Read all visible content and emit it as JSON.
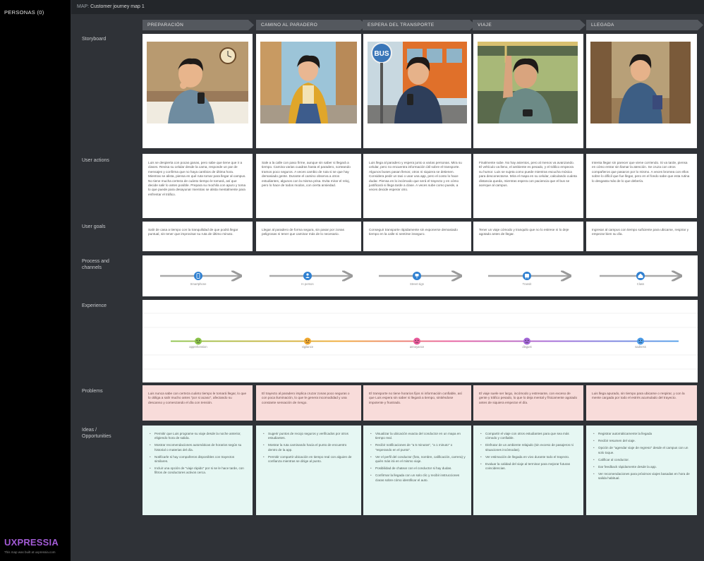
{
  "sidebar": {
    "personas_label": "PERSONAS (0)",
    "brand": "UXPRESSIA",
    "brand_sub": "This map was built at uxpressia.com"
  },
  "topbar": {
    "prefix": "MAP:",
    "title": "Customer journey map 1"
  },
  "stages": [
    "PREPARACIÓN",
    "CAMINO AL PARADERO",
    "ESPERA DEL TRANSPORTE",
    "VIAJE",
    "LLEGADA"
  ],
  "rows": {
    "storyboard": "Storyboard",
    "actions": "User actions",
    "goals": "User goals",
    "process": "Process and channels",
    "experience": "Experience",
    "problems": "Problems",
    "ideas": "Ideas / Opportunities"
  },
  "actions": [
    "Luis se despierta con pocas ganas, pero sabe que tiene que ir a clases. Revisa su celular desde la cama, responde un par de mensajes y confirma que no haya cambios de última hora. Mientras se alista, piensa en qué ruta tomar para llegar al campus. No tiene mucha certeza de cuánto tiempo le tomará, así que decide salir lo antes posible. Prepara su mochila con apuro y toma lo que puede para desayunar mientras se alista mentalmente para enfrentar el tráfico.",
    "Sale a la calle con paso firme, aunque sin saber si llegará a tiempo. Camina varias cuadras hasta el paradero, sorteando  tramos poco seguros. A veces cambio de ruta si se que hay demasiado gente. Durante el camino observa a otros estudiantes, algunos con la misma prisa. Evita mirar el reloj, pero lo hace de todos modos, con cierta ansiedad.",
    "Luis llega al paradero y espera junto a varias personas. Mira su celular, pero no encuentra información útil sobre el transporte. Algunos buses pasan llenos; otros ni siquiera se detienen. Considera pedir un taxi o usar una app, pero el costo lo hace dudar. Piensa en lo incómodo que será el trayecto y en cómo justificará si llega tarde a clase. A veces sube como puede, a veces decide esperar otro.",
    "Finalmente sube. No hay asientos, pero al menos va avanzando. El vehículo va lleno, el ambiente es pesado, y el tráfico empeora su humor. Luis se sujeta como puede mientras escucha música para desconectarse. Mira el mapa en su celular, calculando cuánta distancia queda, mientras espera con paciencia que el bus se acerque al campus.",
    "Intenta llegar sin parecer que viene corriendo. Si va tarde, piensa en cómo entrar sin llamar la atención. Se cruza con otros compañeros que pasaron por lo mismo. A veces bromea con ellos sobre lo difícil que fue llegar, pero en el fondo sabe que esta rutina lo desgasta más de lo que debería."
  ],
  "goals": [
    "Salir de casa a tiempo con la tranquilidad de que podrá llegar puntual, sin tener que improvisar su ruta de último minuto.",
    "Llegar al paradero de forma segura, sin pasar por zonas peligrosas ni tener que caminar más de lo necesario.",
    "Conseguir transporte rápidamente sin exponerse demasiado tiempo en la calle ni sentirse inseguro.",
    "Tener un viaje cómodo y tranquilo que no lo estrese ni lo deje agotado antes de llegar.",
    "Ingresar al campus con tiempo suficiente para ubicarse, respirar y empezar bien su día."
  ],
  "channels": [
    {
      "label": "Smartphone",
      "icon": "smartphone-icon"
    },
    {
      "label": "In person",
      "icon": "person-icon"
    },
    {
      "label": "Street sign",
      "icon": "street-sign-icon"
    },
    {
      "label": "Transit",
      "icon": "transit-icon"
    },
    {
      "label": "Class",
      "icon": "class-icon"
    }
  ],
  "experience": [
    {
      "label": "apprehension",
      "score": 0.0,
      "color": "#8bc34a"
    },
    {
      "label": "vigilance",
      "score": 0.0,
      "color": "#f0a830"
    },
    {
      "label": "annoyance",
      "score": 0.0,
      "color": "#e85a9a"
    },
    {
      "label": "disgust",
      "score": 0.0,
      "color": "#a266d6"
    },
    {
      "label": "sadness",
      "score": 0.0,
      "color": "#4a9be8"
    }
  ],
  "problems": [
    "Luis nunca sabe con certeza cuánto tiempo le tomará llegar, lo que lo obliga a salir mucho antes \"por si acaso\", afectando su descanso y comenzando el día con tensión.",
    "El trayecto al paradero implica cruzar zonas poco seguras o con poca iluminación, lo que le genera incomodidad y una constante sensación de riesgo.",
    "El transporte no tiene horarios fijos ni información confiable, así que Luis espera sin saber si llegará a tiempo, sintiéndose impotente y frustrado.",
    "El viaje suele ser largo, incómodo y estresante, con exceso de gente y tráfico pesado, lo que lo deja mental y físicamente agotado antes de siquiera empezar el día.",
    "Luis llega apurado, sin tiempo para ubicarse o respirar, y con la mente cargada por todo el estrés acumulado del trayecto."
  ],
  "ideas": [
    [
      "Permitir que Luis programe su viaje desde la noche anterior, eligiendo hora de salida.",
      "Mostrar recomendaciones automáticas de horarios según su historial o materias del día.",
      "Notificarle si hay compañeros disponibles con trayectos similares.",
      "Incluir una opción de \"viaje rápido\" por si se le hace tarde, con filtros de conductores activos cerca."
    ],
    [
      "Sugerir puntos de recojo seguros y verificados por otros estudiantes.",
      "Mostrar la ruta caminando hacia el punto de encuentro dentro de la app.",
      "Permitir compartir ubicación en tiempo real con alguien de confianza mientras se dirige al punto."
    ],
    [
      "Visualizar la ubicación exacta del conductor en un mapa en tiempo real.",
      "Recibir notificaciones de \"a 5 minutos\", \"a 1 minuto\" o \"esperando en el punto\".",
      "Ver el perfil del conductor (foto, nombre, calificación, carrera) y quién más irá en el mismo viaje.",
      "Posibilidad de chatear con el conductor si hay dudas.",
      "Confirmar la llegada con un solo clic y recibir instrucciones claras sobre cómo identificar el auto."
    ],
    [
      "Compartir el viaje con otros estudiantes para que sea más cómodo y confiable.",
      "Disfrutar de un ambiente relajado (sin exceso de pasajeros ni situaciones incómodas).",
      "Ver estimación de llegada en vivo durante todo el trayecto.",
      "Evaluar la calidad del viaje al terminar para mejorar futuras coincidencias."
    ],
    [
      "Registrar automáticamente la llegada",
      "Recibir resumen del viaje.",
      "Opción de \"agendar viaje de regreso\" desde el campus con un solo toque.",
      "Calificar al conductor.",
      "Dar feedback rápidamente desde la app.",
      "Ver recomendaciones para próximos viajes basadas en hora de salida habitual."
    ]
  ],
  "storyboard_props": [
    "wall-clock",
    "yellow-jacket",
    "bus-sign",
    "bus-handle",
    "school-hallway"
  ],
  "storyboard_sign": "BUS",
  "colors": {
    "accent": "#2f80d1",
    "problem_bg": "#f8dcda",
    "idea_bg": "#e6f7f3",
    "brand": "#a35bd6"
  }
}
